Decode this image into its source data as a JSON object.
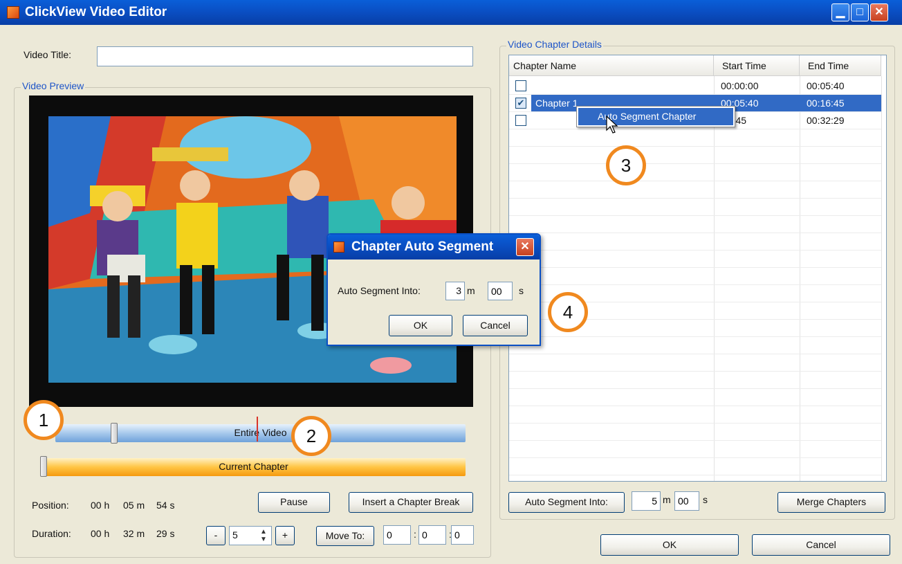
{
  "window": {
    "title": "ClickView Video Editor"
  },
  "video_title": {
    "label": "Video Title:",
    "value": ""
  },
  "video_preview": {
    "group_label": "Video Preview",
    "entire_video_label": "Entire Video",
    "current_chapter_label": "Current Chapter",
    "entire_video_position": 0.18,
    "current_chapter_position": 0.01,
    "position": {
      "label": "Position:",
      "h": "00 h",
      "m": "05 m",
      "s": "54 s"
    },
    "duration": {
      "label": "Duration:",
      "h": "00 h",
      "m": "32 m",
      "s": "29 s"
    },
    "pause_label": "Pause",
    "insert_break_label": "Insert a Chapter Break",
    "minus_label": "-",
    "step_value": "5",
    "plus_label": "+",
    "move_to_label": "Move To:",
    "move_to": [
      "0",
      "0",
      "0"
    ],
    "colon": ":"
  },
  "chapter_details": {
    "group_label": "Video Chapter Details",
    "columns": [
      "Chapter Name",
      "Start Time",
      "End Time"
    ],
    "rows": [
      {
        "checked": false,
        "name": "",
        "start": "00:00:00",
        "end": "00:05:40"
      },
      {
        "checked": true,
        "name": "Chapter 1",
        "start": "00:05:40",
        "end": "00:16:45",
        "selected": true
      },
      {
        "checked": false,
        "name": "",
        "start": "16:45",
        "end": "00:32:29"
      }
    ],
    "auto_segment_button": "Auto Segment Into:",
    "auto_segment_min": "5",
    "auto_segment_sec": "00",
    "m_unit": "m",
    "s_unit": "s",
    "merge_button": "Merge Chapters"
  },
  "context_menu": {
    "item": "Auto Segment Chapter"
  },
  "dialog": {
    "title": "Chapter Auto Segment",
    "label": "Auto Segment Into:",
    "min_value": "3",
    "m_unit": "m",
    "sec_value": "00",
    "s_unit": "s",
    "ok": "OK",
    "cancel": "Cancel"
  },
  "footer": {
    "ok": "OK",
    "cancel": "Cancel"
  },
  "callouts": [
    "1",
    "2",
    "3",
    "4"
  ],
  "colors": {
    "accent": "#1d54c8",
    "selection": "#316ac5",
    "callout": "#f0891f",
    "titlebar": "#0a4fc4"
  }
}
